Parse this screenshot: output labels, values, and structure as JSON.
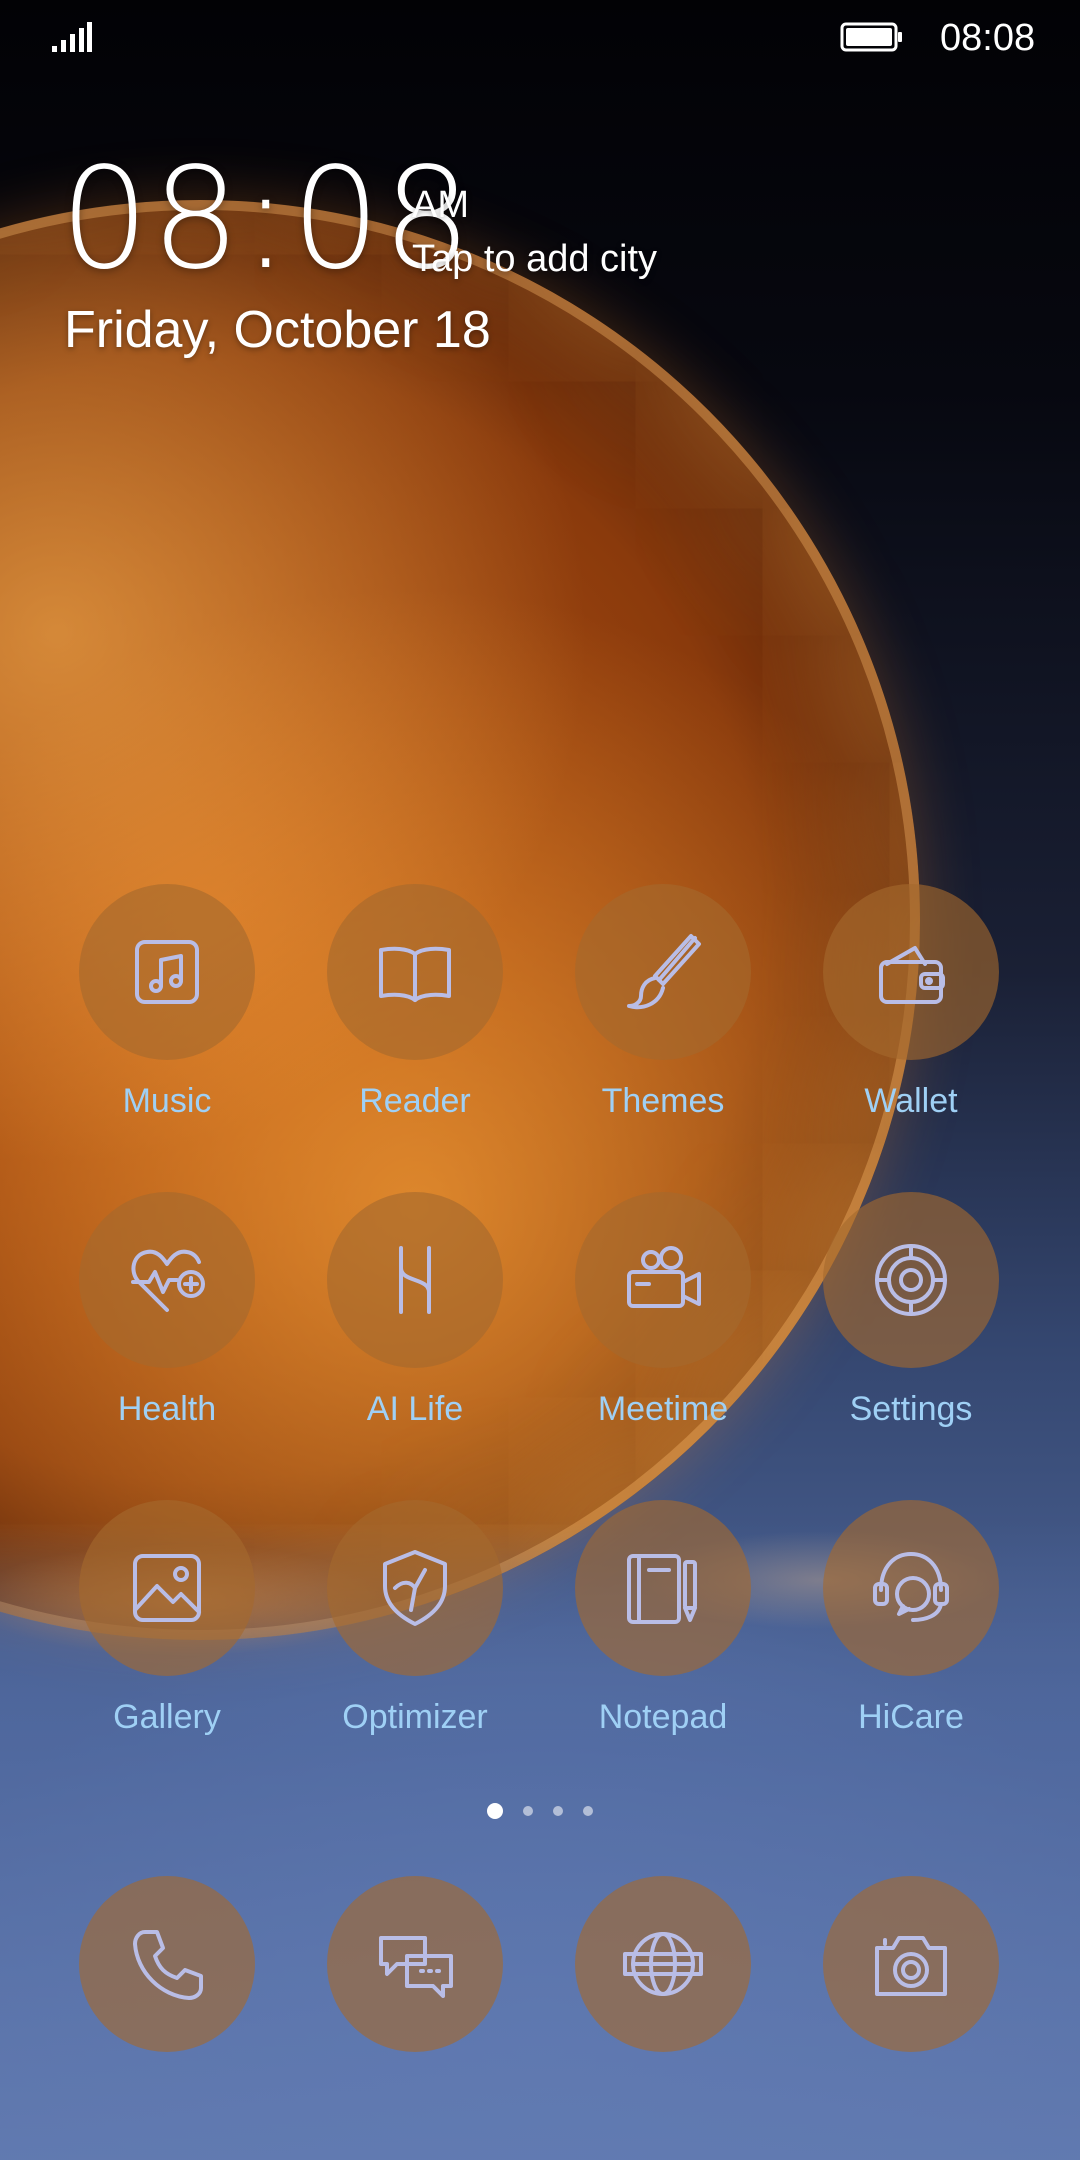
{
  "status_bar": {
    "time": "08:08",
    "signal_icon": "signal-bars-icon",
    "battery_icon": "battery-full-icon"
  },
  "clock_widget": {
    "time": "08:08",
    "ampm": "AM",
    "city_prompt": "Tap to add city",
    "date": "Friday, October 18"
  },
  "colors": {
    "icon_bg": "#a5692d",
    "icon_stroke": "#b9bde6",
    "label": "#9fd0f5"
  },
  "apps": [
    {
      "label": "Music",
      "icon": "music-icon"
    },
    {
      "label": "Reader",
      "icon": "book-icon"
    },
    {
      "label": "Themes",
      "icon": "paintbrush-icon"
    },
    {
      "label": "Wallet",
      "icon": "wallet-icon"
    },
    {
      "label": "Health",
      "icon": "heart-pulse-icon"
    },
    {
      "label": "AI Life",
      "icon": "ai-life-icon"
    },
    {
      "label": "Meetime",
      "icon": "video-camera-icon"
    },
    {
      "label": "Settings",
      "icon": "gear-icon"
    },
    {
      "label": "Gallery",
      "icon": "image-icon"
    },
    {
      "label": "Optimizer",
      "icon": "shield-icon"
    },
    {
      "label": "Notepad",
      "icon": "notepad-icon"
    },
    {
      "label": "HiCare",
      "icon": "headset-icon"
    }
  ],
  "page_indicator": {
    "pages": 4,
    "current": 1
  },
  "dock": [
    {
      "icon": "phone-icon"
    },
    {
      "icon": "messages-icon"
    },
    {
      "icon": "browser-icon"
    },
    {
      "icon": "camera-icon"
    }
  ]
}
